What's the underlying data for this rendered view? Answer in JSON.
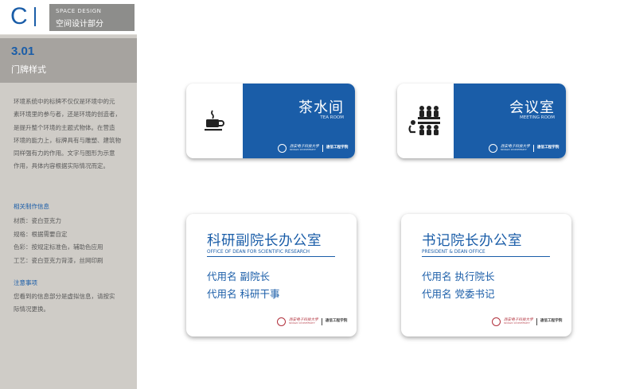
{
  "brand": {
    "letter": "C",
    "category_en": "SPACE DESIGN",
    "category_cn": "空间设计部分"
  },
  "section": {
    "number": "3.01",
    "title": "门牌样式",
    "description": [
      "环境系统中的标牌不仅仅是环境中的元",
      "素环境里的参与者，还是环境的创造者，",
      "是提升整个环境的主题式物体。在营造",
      "环境的能力上，标牌具有与雕塑、建筑物",
      "同样强有力的作用。文字与图形为示意",
      "作用，具体内容根据实际情况而定。"
    ],
    "info_title": "相关制作信息",
    "info_items": [
      "材质：瓷白亚克力",
      "规格：根据需要自定",
      "色彩：按规定标准色，辅助色应用",
      "工艺：瓷白亚克力背漆，丝网印刷"
    ],
    "note_title": "注意事项",
    "note_text": [
      "您看到的信息部分是虚拟信息，请按实",
      "际情况更换。"
    ]
  },
  "signs": {
    "tea_room": {
      "cn": "茶水间",
      "en": "TEA ROOM",
      "icon": "teacup-icon"
    },
    "meeting_room": {
      "cn": "会议室",
      "en": "MEETING ROOM",
      "icon": "meeting-people-icon"
    },
    "vice_dean_office": {
      "cn": "科研副院长办公室",
      "en": "OFFICE OF  DEAN FOR SCIENTIFIC RESEARCH",
      "lines": [
        "代用名   副院长",
        "代用名   科研干事"
      ]
    },
    "dean_office": {
      "cn": "书记院长办公室",
      "en": "PRESIDENT & DEAN OFFICE",
      "lines": [
        "代用名   执行院长",
        "代用名   党委书记"
      ]
    },
    "logo": {
      "school": "西安电子科技大学",
      "school_en": "XIDIAN UNIVERSITY",
      "college": "通信工程学院"
    }
  },
  "colors": {
    "brand_blue": "#1a5da8",
    "sidebar_gray": "#cfccc7",
    "title_gray": "#a6a39f",
    "seal_red": "#b1303c"
  }
}
